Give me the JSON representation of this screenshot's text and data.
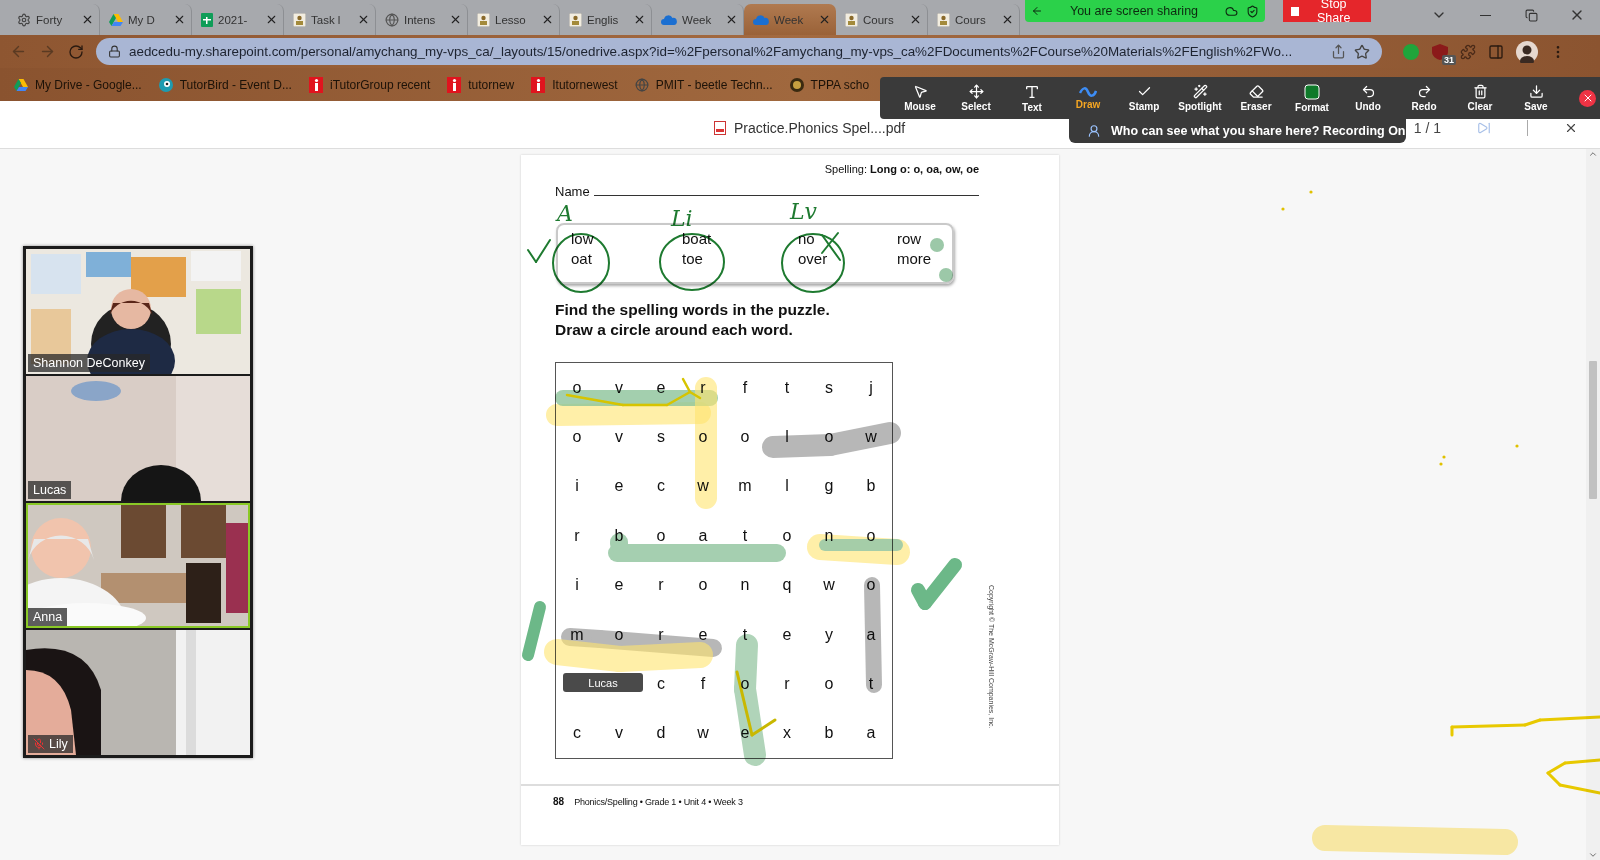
{
  "browser": {
    "tabs": [
      {
        "label": "Forty",
        "kind": "gear",
        "selected": false
      },
      {
        "label": "My D",
        "kind": "drive",
        "selected": false
      },
      {
        "label": "2021-",
        "kind": "sheet",
        "selected": false
      },
      {
        "label": "Task l",
        "kind": "page",
        "selected": false
      },
      {
        "label": "Intens",
        "kind": "globe",
        "selected": false
      },
      {
        "label": "Lesso",
        "kind": "page",
        "selected": false
      },
      {
        "label": "Englis",
        "kind": "page",
        "selected": false
      },
      {
        "label": "Week",
        "kind": "cloud",
        "selected": false
      },
      {
        "label": "Week",
        "kind": "cloud",
        "selected": true
      },
      {
        "label": "Cours",
        "kind": "page",
        "selected": false
      },
      {
        "label": "Cours",
        "kind": "page",
        "selected": false
      }
    ],
    "address": "aedcedu-my.sharepoint.com/personal/amychang_my-vps_ca/_layouts/15/onedrive.aspx?id=%2Fpersonal%2Famychang_my-vps_ca%2FDocuments%2FCourse%20Materials%2FEnglish%2FWo...",
    "extension_badge": "31",
    "bookmarks": [
      {
        "label": "My Drive - Google...",
        "kind": "drive"
      },
      {
        "label": "TutorBird - Event D...",
        "kind": "bird"
      },
      {
        "label": "iTutorGroup recent",
        "kind": "itutor"
      },
      {
        "label": "tutornew",
        "kind": "itutor"
      },
      {
        "label": "Itutornewest",
        "kind": "itutor"
      },
      {
        "label": "PMIT - beetle Techn...",
        "kind": "globe"
      },
      {
        "label": "TPPA scho",
        "kind": "crest"
      }
    ]
  },
  "sharing_bar": {
    "status": "You are screen sharing",
    "stop_button": "Stop Share"
  },
  "annotate_toolbar": {
    "tools": [
      {
        "label": "Mouse",
        "selected": false
      },
      {
        "label": "Select",
        "selected": false
      },
      {
        "label": "Text",
        "selected": false
      },
      {
        "label": "Draw",
        "selected": true
      },
      {
        "label": "Stamp",
        "selected": false
      },
      {
        "label": "Spotlight",
        "selected": false
      },
      {
        "label": "Eraser",
        "selected": false
      },
      {
        "label": "Format",
        "selected": false
      },
      {
        "label": "Undo",
        "selected": false
      },
      {
        "label": "Redo",
        "selected": false
      },
      {
        "label": "Clear",
        "selected": false
      },
      {
        "label": "Save",
        "selected": false
      }
    ],
    "banner": "Who can see what you share here? Recording On"
  },
  "pdf_viewer": {
    "file_name": "Practice.Phonics Spel....pdf",
    "page_counter": "1 / 1"
  },
  "participants": [
    {
      "name": "Shannon DeConkey",
      "speaking": false,
      "muted": false
    },
    {
      "name": "Lucas",
      "speaking": false,
      "muted": false
    },
    {
      "name": "Anna",
      "speaking": true,
      "muted": false
    },
    {
      "name": "Lily",
      "speaking": false,
      "muted": true
    }
  ],
  "worksheet": {
    "header": "Spelling: **Long o: o, oa, ow, oe**",
    "name_label": "Name",
    "word_columns": [
      [
        "low",
        "oat"
      ],
      [
        "boat",
        "toe"
      ],
      [
        "no",
        "over"
      ],
      [
        "row",
        "more"
      ]
    ],
    "instructions": [
      "Find the spelling words in the puzzle.",
      "Draw a circle around each word."
    ],
    "puzzle": {
      "rows": [
        {
          "cells": [
            "o",
            "v",
            "e",
            "r",
            "f",
            "t",
            "s",
            "j"
          ]
        },
        {
          "cells": [
            "o",
            "v",
            "s",
            "o",
            "o",
            "l",
            "o",
            "w"
          ]
        },
        {
          "cells": [
            "i",
            "e",
            "c",
            "w",
            "m",
            "l",
            "g",
            "b"
          ]
        },
        {
          "cells": [
            "r",
            "b",
            "o",
            "a",
            "t",
            "o",
            "n",
            "o"
          ]
        },
        {
          "cells": [
            "i",
            "e",
            "r",
            "o",
            "n",
            "q",
            "w",
            "o"
          ]
        },
        {
          "cells": [
            "m",
            "o",
            "r",
            "e",
            "t",
            "e",
            "y",
            "a"
          ]
        },
        {
          "label": "Lucas",
          "cells": [
            "",
            "",
            "c",
            "f",
            "o",
            "r",
            "o",
            "t"
          ]
        },
        {
          "cells": [
            "c",
            "v",
            "d",
            "w",
            "e",
            "x",
            "b",
            "a"
          ]
        }
      ]
    },
    "copyright": "Copyright © The McGraw-Hill Companies, Inc.",
    "page_number": "88",
    "footer": "Phonics/Spelling • Grade 1 • Unit 4 • Week 3"
  },
  "annotations": {
    "handwriting": [
      "A",
      "Li",
      "Lv"
    ]
  }
}
